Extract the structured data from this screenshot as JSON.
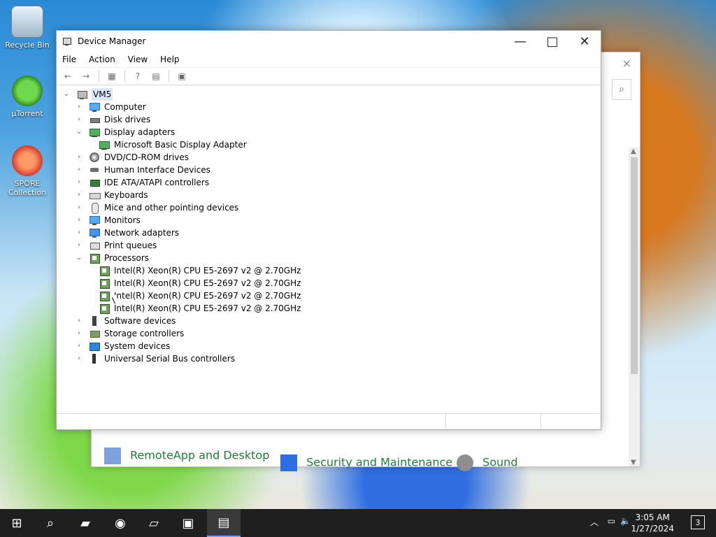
{
  "desktop": {
    "icons": [
      {
        "label": "Recycle Bin"
      },
      {
        "label": "µTorrent"
      },
      {
        "label": "SPORE Collection"
      }
    ]
  },
  "control_panel": {
    "close": "×",
    "search_icon": "⌕",
    "items": [
      {
        "label": "RemoteApp and Desktop"
      },
      {
        "label": "Security and Maintenance"
      },
      {
        "label": "Sound"
      }
    ]
  },
  "device_manager": {
    "title": "Device Manager",
    "menus": [
      "File",
      "Action",
      "View",
      "Help"
    ],
    "controls": {
      "minimize": "—",
      "maximize": "□",
      "close": "✕"
    },
    "toolbar": [
      "back-icon",
      "forward-icon",
      "properties-icon",
      "help-icon",
      "view-icon",
      "scan-icon"
    ],
    "tree": [
      {
        "label": "VM5"
      },
      {
        "label": "Computer"
      },
      {
        "label": "Disk drives"
      },
      {
        "label": "Display adapters"
      },
      {
        "label": "Microsoft Basic Display Adapter"
      },
      {
        "label": "DVD/CD-ROM drives"
      },
      {
        "label": "Human Interface Devices"
      },
      {
        "label": "IDE ATA/ATAPI controllers"
      },
      {
        "label": "Keyboards"
      },
      {
        "label": "Mice and other pointing devices"
      },
      {
        "label": "Monitors"
      },
      {
        "label": "Network adapters"
      },
      {
        "label": "Print queues"
      },
      {
        "label": "Processors"
      },
      {
        "label": "Intel(R) Xeon(R) CPU E5-2697 v2 @ 2.70GHz"
      },
      {
        "label": "Intel(R) Xeon(R) CPU E5-2697 v2 @ 2.70GHz"
      },
      {
        "label": "Intel(R) Xeon(R) CPU E5-2697 v2 @ 2.70GHz"
      },
      {
        "label": "Intel(R) Xeon(R) CPU E5-2697 v2 @ 2.70GHz"
      },
      {
        "label": "Software devices"
      },
      {
        "label": "Storage controllers"
      },
      {
        "label": "System devices"
      },
      {
        "label": "Universal Serial Bus controllers"
      }
    ]
  },
  "taskbar": {
    "time": "3:05 AM",
    "date": "1/27/2024",
    "notification_count": "3"
  }
}
